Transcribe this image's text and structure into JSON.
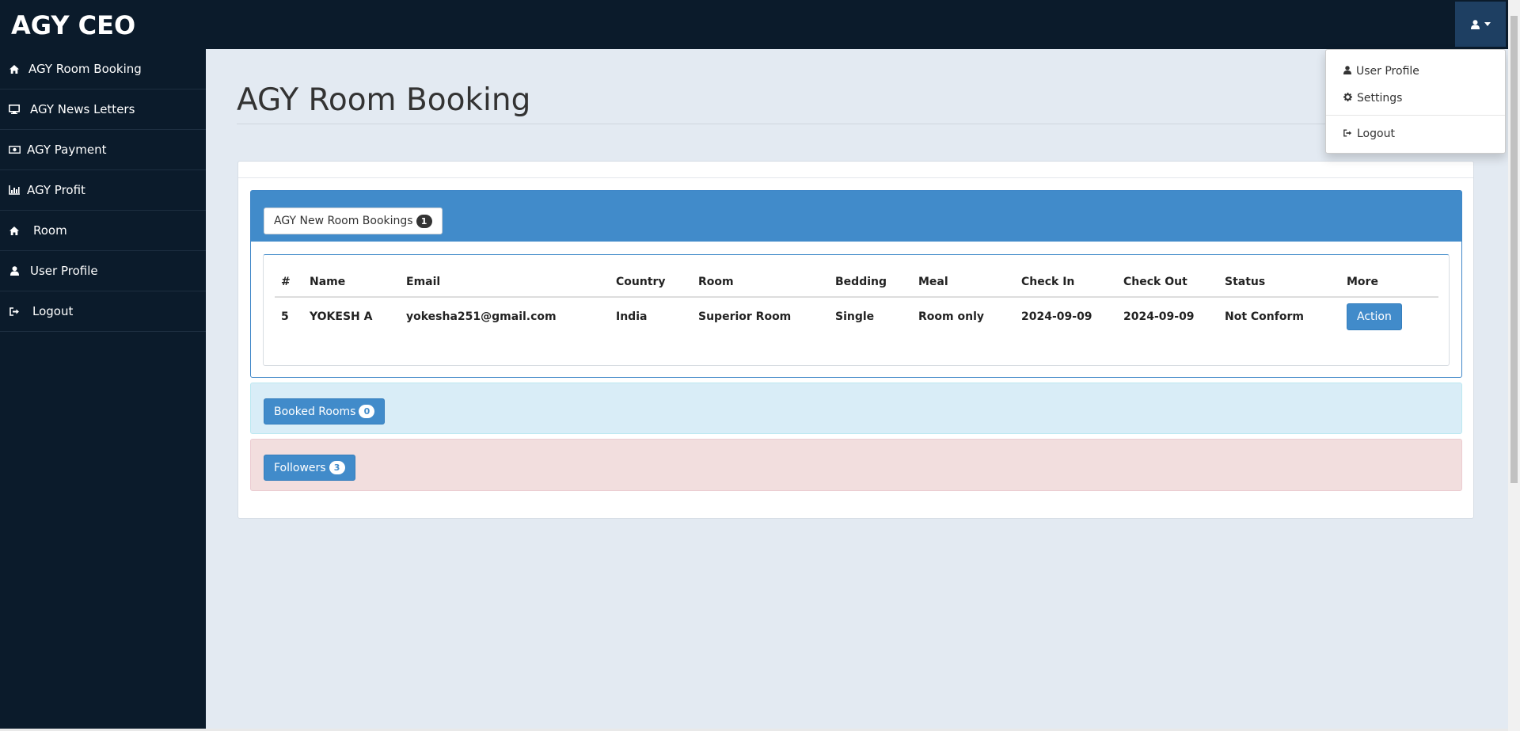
{
  "app": {
    "brand": "AGY CEO"
  },
  "sidebar": {
    "items": [
      {
        "label": "AGY Room Booking",
        "icon": "home-icon"
      },
      {
        "label": "AGY News Letters",
        "icon": "desktop-icon"
      },
      {
        "label": "AGY Payment",
        "icon": "money-icon"
      },
      {
        "label": "AGY Profit",
        "icon": "bar-chart-icon"
      },
      {
        "label": "Room",
        "icon": "home-icon"
      },
      {
        "label": "User Profile",
        "icon": "user-icon"
      },
      {
        "label": "Logout",
        "icon": "sign-out-icon"
      }
    ]
  },
  "header": {
    "user_menu_icon": "user-icon"
  },
  "user_menu": {
    "items": [
      {
        "label": "User Profile",
        "icon": "user-icon"
      },
      {
        "label": "Settings",
        "icon": "gear-icon"
      },
      {
        "label": "Logout",
        "icon": "sign-out-icon"
      }
    ]
  },
  "page": {
    "title": "AGY Room Booking"
  },
  "new_bookings": {
    "button_label": "AGY New Room Bookings",
    "count": "1",
    "columns": [
      "#",
      "Name",
      "Email",
      "Country",
      "Room",
      "Bedding",
      "Meal",
      "Check In",
      "Check Out",
      "Status",
      "More"
    ],
    "rows": [
      {
        "id": "5",
        "name": "YOKESH A",
        "email": "yokesha251@gmail.com",
        "country": "India",
        "room": "Superior Room",
        "bedding": "Single",
        "meal": "Room only",
        "check_in": "2024-09-09",
        "check_out": "2024-09-09",
        "status": "Not Conform",
        "action_label": "Action"
      }
    ]
  },
  "booked_rooms": {
    "button_label": "Booked Rooms",
    "count": "0"
  },
  "followers": {
    "button_label": "Followers",
    "count": "3"
  },
  "colors": {
    "topbar": "#0b1b2b",
    "accent": "#418bca",
    "info_bg": "#d9edf7",
    "danger_bg": "#f2dede",
    "content_bg": "#e3eaf2"
  }
}
